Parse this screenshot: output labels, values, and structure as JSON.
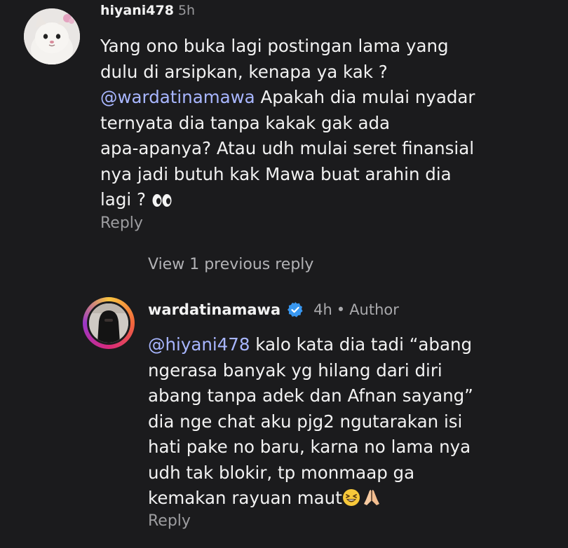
{
  "comment": {
    "username": "hiyani478",
    "time": "5h",
    "line1": "Yang ono buka lagi postingan lama yang",
    "line2": "dulu di arsipkan, kenapa ya kak ?",
    "mention": "@wardatinamawa",
    "line3_rest": " Apakah dia mulai nyadar",
    "line4": "ternyata dia tanpa kakak gak ada",
    "line5": "apa-apanya? Atau udh mulai seret finansial",
    "line6": "nya jadi butuh kak Mawa buat arahin dia",
    "line7": "lagi ? ",
    "emoji": "eyes-emoji",
    "reply_label": "Reply",
    "avatar": "cat-avatar"
  },
  "view_previous": "View 1 previous reply",
  "reply": {
    "username": "wardatinamawa",
    "verified_icon": "verified-badge-icon",
    "time": "4h",
    "separator": "•",
    "author_label": "Author",
    "mention": "@hiyani478",
    "line1_rest": " kalo kata dia tadi “abang",
    "line2": "ngerasa banyak yg hilang dari diri",
    "line3": "abang tanpa adek dan Afnan sayang”",
    "line4": "dia nge chat aku pjg2 ngutarakan isi",
    "line5": "hati pake no baru, karna no lama nya",
    "line6": "udh tak blokir, tp monmaap ga",
    "line7": "kemakan rayuan maut",
    "emojis": [
      "grinning-squinting-emoji",
      "praying-hands-emoji"
    ],
    "reply_label": "Reply",
    "avatar": "veiled-woman-avatar",
    "ring_colors": [
      "#f9c440",
      "#f2663b",
      "#d8297b",
      "#9a37c8"
    ]
  },
  "colors": {
    "background": "#1b1b1d",
    "mention": "#a8b6ff",
    "secondary_text": "#9d9da0",
    "verified": "#3897f0"
  }
}
